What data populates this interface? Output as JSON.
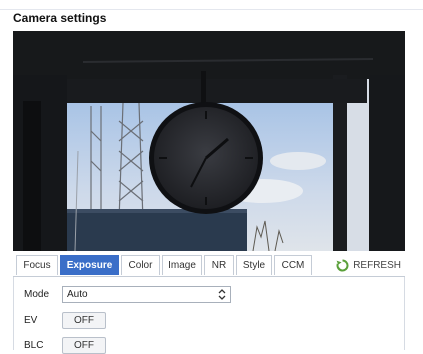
{
  "panel": {
    "title": "Camera settings"
  },
  "tabs": [
    {
      "label": "Focus",
      "active": false
    },
    {
      "label": "Exposure",
      "active": true
    },
    {
      "label": "Color",
      "active": false
    },
    {
      "label": "Image",
      "active": false
    },
    {
      "label": "NR",
      "active": false
    },
    {
      "label": "Style",
      "active": false
    },
    {
      "label": "CCM",
      "active": false
    }
  ],
  "toolbar": {
    "refresh_label": "REFRESH"
  },
  "exposure": {
    "mode_label": "Mode",
    "mode_value": "Auto",
    "ev_label": "EV",
    "ev_value": "OFF",
    "blc_label": "BLC",
    "blc_value": "OFF"
  },
  "colors": {
    "accent": "#3a6ec8",
    "refresh_icon": "#5aa03a"
  }
}
